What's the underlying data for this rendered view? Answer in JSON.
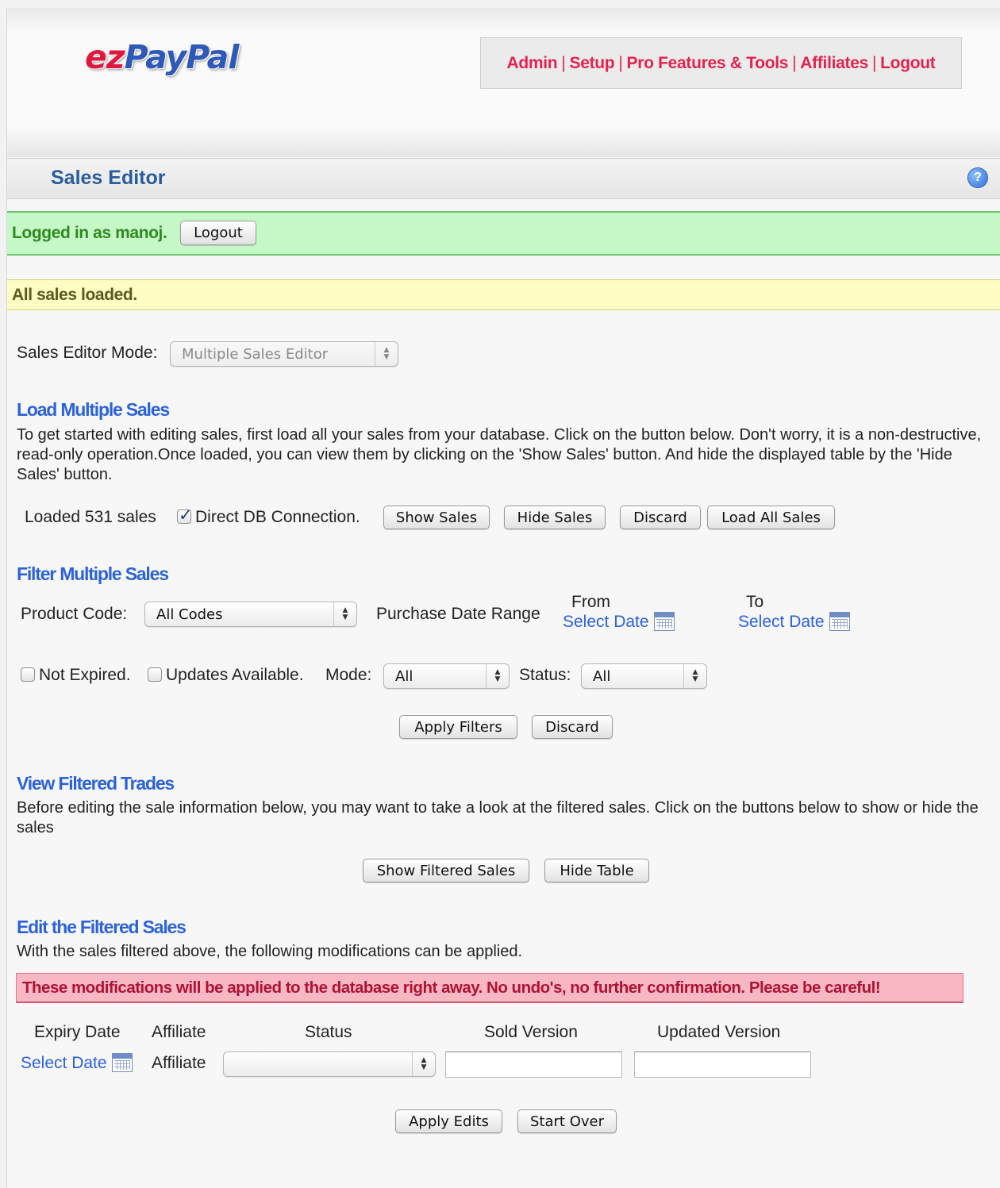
{
  "header": {
    "logo": {
      "ez": "ez",
      "paypal": "PayPal"
    },
    "nav": [
      "Admin",
      "Setup",
      "Pro Features & Tools",
      "Affiliates",
      "Logout"
    ],
    "nav_separator": "|"
  },
  "titlebar": {
    "title": "Sales Editor",
    "help_icon": "question-circle-icon",
    "help_glyph": "?"
  },
  "login": {
    "text": "Logged in as manoj.",
    "logout_button": "Logout"
  },
  "notice": {
    "text": "All sales loaded."
  },
  "mode": {
    "label": "Sales Editor Mode:",
    "selected": "Multiple Sales Editor"
  },
  "load": {
    "heading": "Load Multiple Sales",
    "description": "To get started with editing sales, first load all your sales from your database. Click on the button below. Don't worry, it is a non-destructive, read-only operation.Once loaded, you can view them by clicking on the 'Show Sales' button. And hide the displayed table by the 'Hide Sales' button.",
    "status": "Loaded 531 sales",
    "direct_db_label": "Direct DB Connection.",
    "direct_db_checked": true,
    "buttons": {
      "show": "Show Sales",
      "hide": "Hide Sales",
      "discard": "Discard",
      "load_all": "Load All Sales"
    }
  },
  "filter": {
    "heading": "Filter Multiple Sales",
    "product_code_label": "Product Code:",
    "product_code_selected": "All Codes",
    "date_range_label": "Purchase Date Range",
    "from_label": "From",
    "to_label": "To",
    "select_date": "Select Date",
    "not_expired_label": "Not Expired.",
    "updates_available_label": "Updates Available.",
    "mode_label": "Mode:",
    "mode_selected": "All",
    "status_label": "Status:",
    "status_selected": "All",
    "apply_button": "Apply Filters",
    "discard_button": "Discard"
  },
  "view": {
    "heading": "View Filtered Trades",
    "description": "Before editing the sale information below, you may want to take a look at the filtered sales. Click on the buttons below to show or hide the sales",
    "show_button": "Show Filtered Sales",
    "hide_button": "Hide Table"
  },
  "edit": {
    "heading": "Edit the Filtered Sales",
    "description": "With the sales filtered above, the following modifications can be applied.",
    "warning": "These modifications will be applied to the database right away. No undo's, no further confirmation. Please be careful!",
    "columns": [
      "Expiry Date",
      "Affiliate",
      "Status",
      "Sold Version",
      "Updated Version"
    ],
    "select_date": "Select Date",
    "affiliate_value": "Affiliate",
    "status_selected": "",
    "sold_version_value": "",
    "updated_version_value": "",
    "apply_button": "Apply Edits",
    "start_over_button": "Start Over"
  }
}
